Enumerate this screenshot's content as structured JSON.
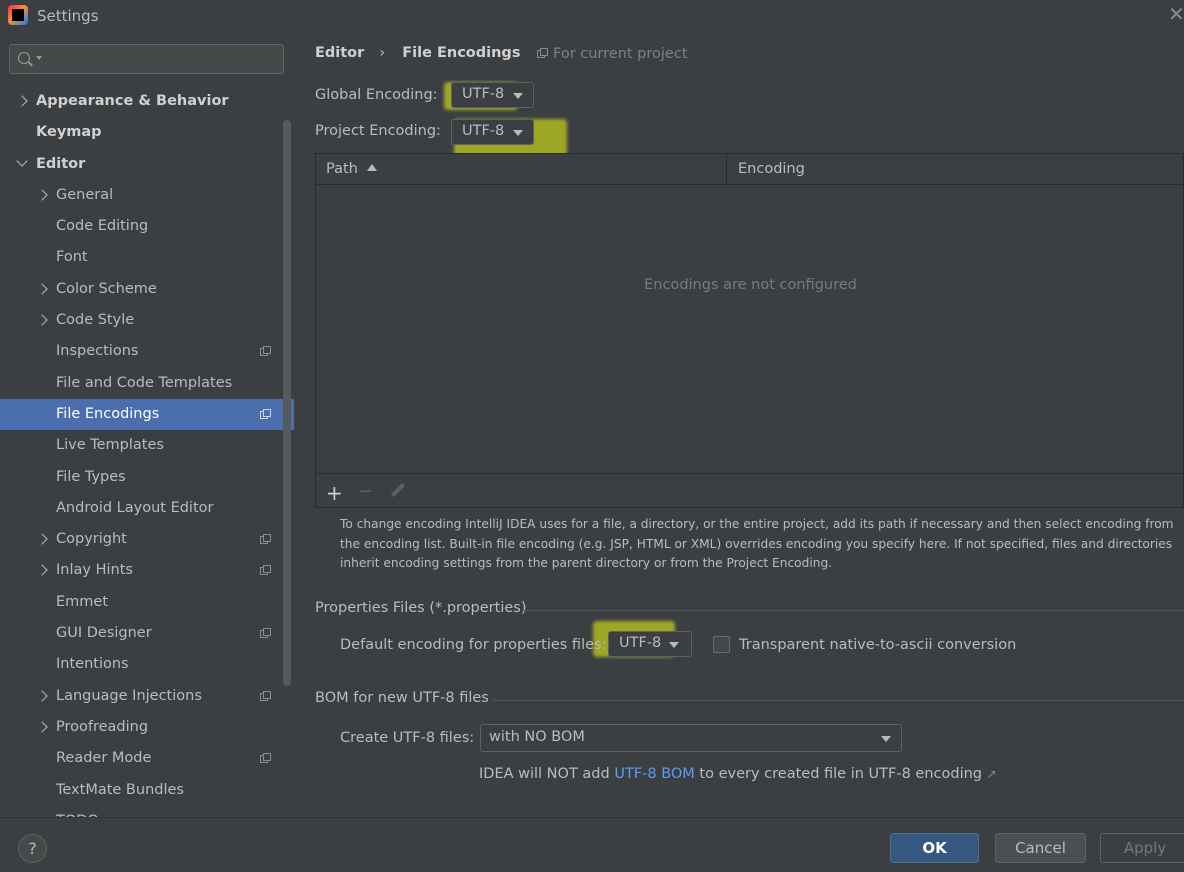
{
  "window": {
    "title": "Settings"
  },
  "search": {
    "placeholder": ""
  },
  "sidebar": {
    "items": [
      {
        "label": "Appearance & Behavior",
        "level": 0,
        "expandable": true,
        "expanded": false,
        "bold": true,
        "project": false,
        "selected": false
      },
      {
        "label": "Keymap",
        "level": 0,
        "expandable": false,
        "bold": true,
        "project": false,
        "selected": false
      },
      {
        "label": "Editor",
        "level": 0,
        "expandable": true,
        "expanded": true,
        "bold": true,
        "project": false,
        "selected": false
      },
      {
        "label": "General",
        "level": 1,
        "expandable": true,
        "expanded": false,
        "bold": false,
        "project": false,
        "selected": false
      },
      {
        "label": "Code Editing",
        "level": 1,
        "expandable": false,
        "bold": false,
        "project": false,
        "selected": false
      },
      {
        "label": "Font",
        "level": 1,
        "expandable": false,
        "bold": false,
        "project": false,
        "selected": false
      },
      {
        "label": "Color Scheme",
        "level": 1,
        "expandable": true,
        "expanded": false,
        "bold": false,
        "project": false,
        "selected": false
      },
      {
        "label": "Code Style",
        "level": 1,
        "expandable": true,
        "expanded": false,
        "bold": false,
        "project": false,
        "selected": false
      },
      {
        "label": "Inspections",
        "level": 1,
        "expandable": false,
        "bold": false,
        "project": true,
        "selected": false
      },
      {
        "label": "File and Code Templates",
        "level": 1,
        "expandable": false,
        "bold": false,
        "project": false,
        "selected": false
      },
      {
        "label": "File Encodings",
        "level": 1,
        "expandable": false,
        "bold": false,
        "project": true,
        "selected": true
      },
      {
        "label": "Live Templates",
        "level": 1,
        "expandable": false,
        "bold": false,
        "project": false,
        "selected": false
      },
      {
        "label": "File Types",
        "level": 1,
        "expandable": false,
        "bold": false,
        "project": false,
        "selected": false
      },
      {
        "label": "Android Layout Editor",
        "level": 1,
        "expandable": false,
        "bold": false,
        "project": false,
        "selected": false
      },
      {
        "label": "Copyright",
        "level": 1,
        "expandable": true,
        "expanded": false,
        "bold": false,
        "project": true,
        "selected": false
      },
      {
        "label": "Inlay Hints",
        "level": 1,
        "expandable": true,
        "expanded": false,
        "bold": false,
        "project": true,
        "selected": false
      },
      {
        "label": "Emmet",
        "level": 1,
        "expandable": false,
        "bold": false,
        "project": false,
        "selected": false
      },
      {
        "label": "GUI Designer",
        "level": 1,
        "expandable": false,
        "bold": false,
        "project": true,
        "selected": false
      },
      {
        "label": "Intentions",
        "level": 1,
        "expandable": false,
        "bold": false,
        "project": false,
        "selected": false
      },
      {
        "label": "Language Injections",
        "level": 1,
        "expandable": true,
        "expanded": false,
        "bold": false,
        "project": true,
        "selected": false
      },
      {
        "label": "Proofreading",
        "level": 1,
        "expandable": true,
        "expanded": false,
        "bold": false,
        "project": false,
        "selected": false
      },
      {
        "label": "Reader Mode",
        "level": 1,
        "expandable": false,
        "bold": false,
        "project": true,
        "selected": false
      },
      {
        "label": "TextMate Bundles",
        "level": 1,
        "expandable": false,
        "bold": false,
        "project": false,
        "selected": false
      },
      {
        "label": "TODO",
        "level": 1,
        "expandable": false,
        "bold": false,
        "project": false,
        "selected": false
      }
    ]
  },
  "breadcrumb": {
    "parent": "Editor",
    "current": "File Encodings",
    "scope": "For current project"
  },
  "encodings": {
    "global_label": "Global Encoding:",
    "global_value": "UTF-8",
    "project_label": "Project Encoding:",
    "project_value": "UTF-8"
  },
  "table": {
    "columns": [
      "Path",
      "Encoding"
    ],
    "empty_text": "Encodings are not configured",
    "rows": []
  },
  "help_text": "To change encoding IntelliJ IDEA uses for a file, a directory, or the entire project, add its path if necessary and then select encoding from the encoding list. Built-in file encoding (e.g. JSP, HTML or XML) overrides encoding you specify here. If not specified, files and directories inherit encoding settings from the parent directory or from the Project Encoding.",
  "properties": {
    "group_title": "Properties Files (*.properties)",
    "default_label": "Default encoding for properties files:",
    "default_value": "UTF-8",
    "transparent_label": "Transparent native-to-ascii conversion",
    "transparent_checked": false
  },
  "bom": {
    "group_title": "BOM for new UTF-8 files",
    "create_label": "Create UTF-8 files:",
    "create_value": "with NO BOM",
    "note_prefix": "IDEA will NOT add ",
    "note_link": "UTF-8 BOM",
    "note_suffix": " to every created file in UTF-8 encoding"
  },
  "buttons": {
    "help": "?",
    "ok": "OK",
    "cancel": "Cancel",
    "apply": "Apply"
  },
  "colors": {
    "background": "#3c3f41",
    "selection": "#4b6eaf",
    "link": "#589df6",
    "highlight": "#e6ee14"
  }
}
